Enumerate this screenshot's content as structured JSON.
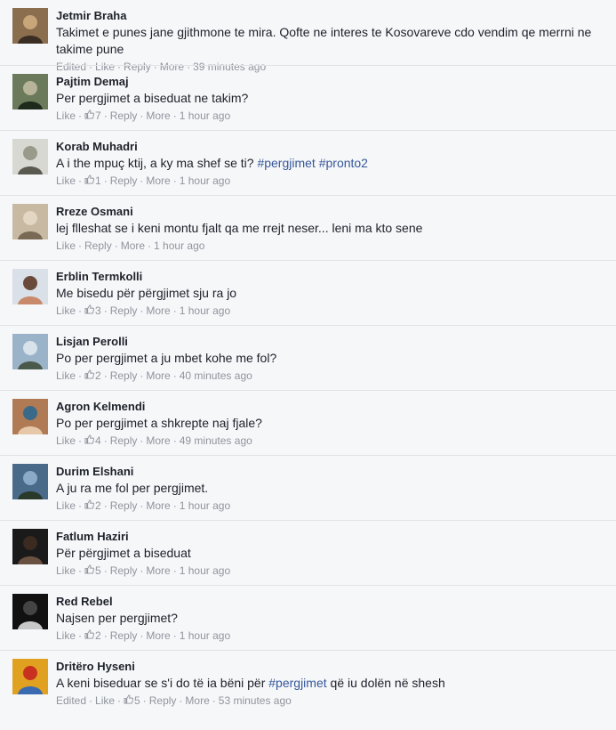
{
  "comments": [
    {
      "name": "Jetmir Braha",
      "text": "Takimet e punes jane gjithmone te mira. Qofte ne interes te Kosovareve cdo vendim qe merrni ne takime pune",
      "edited": "Edited",
      "like": "Like",
      "like_count": "",
      "reply": "Reply",
      "more": "More",
      "time": "39 minutes ago",
      "avatar_colors": [
        "#8a6e4e",
        "#3a2e24",
        "#c9a57a"
      ]
    },
    {
      "name": "Pajtim Demaj",
      "text": "Per pergjimet a biseduat ne takim?",
      "like": "Like",
      "like_count": "7",
      "reply": "Reply",
      "more": "More",
      "time": "1 hour ago",
      "avatar_colors": [
        "#6b7a5a",
        "#1f2a1c",
        "#b8b49a"
      ]
    },
    {
      "name": "Korab Muhadri",
      "text_parts": [
        {
          "t": "A i the mpuç ktij, a ky ma shef se ti? ",
          "tag": false
        },
        {
          "t": "#pergjimet",
          "tag": true
        },
        {
          "t": " ",
          "tag": false
        },
        {
          "t": "#pronto2",
          "tag": true
        }
      ],
      "like": "Like",
      "like_count": "1",
      "reply": "Reply",
      "more": "More",
      "time": "1 hour ago",
      "avatar_colors": [
        "#d8d8d2",
        "#5a5a50",
        "#9a9a8a"
      ]
    },
    {
      "name": "Rreze Osmani",
      "text": "lej flleshat se i keni montu fjalt qa me rrejt neser... leni ma kto sene",
      "like": "Like",
      "like_count": "",
      "reply": "Reply",
      "more": "More",
      "time": "1 hour ago",
      "avatar_colors": [
        "#c7b9a2",
        "#7a6a55",
        "#e3d6c2"
      ]
    },
    {
      "name": "Erblin Termkolli",
      "text": "Me bisedu për përgjimet sju ra jo",
      "like": "Like",
      "like_count": "3",
      "reply": "Reply",
      "more": "More",
      "time": "1 hour ago",
      "avatar_colors": [
        "#d9e0e8",
        "#c88a6a",
        "#6a4a3a"
      ]
    },
    {
      "name": "Lisjan Perolli",
      "text": "Po per pergjimet a ju mbet kohe me fol?",
      "like": "Like",
      "like_count": "2",
      "reply": "Reply",
      "more": "More",
      "time": "40 minutes ago",
      "avatar_colors": [
        "#9bb3c9",
        "#4a5a4a",
        "#d8e2ea"
      ]
    },
    {
      "name": "Agron Kelmendi",
      "text": "Po per pergjimet a shkrepte naj fjale?",
      "like": "Like",
      "like_count": "4",
      "reply": "Reply",
      "more": "More",
      "time": "49 minutes ago",
      "avatar_colors": [
        "#b07a55",
        "#e6c7a8",
        "#3a6a8a"
      ]
    },
    {
      "name": "Durim Elshani",
      "text": "A ju ra me fol per pergjimet.",
      "like": "Like",
      "like_count": "2",
      "reply": "Reply",
      "more": "More",
      "time": "1 hour ago",
      "avatar_colors": [
        "#4a6a8a",
        "#2a3a2a",
        "#8aaac8"
      ]
    },
    {
      "name": "Fatlum Haziri",
      "text": "Për përgjimet a biseduat",
      "like": "Like",
      "like_count": "5",
      "reply": "Reply",
      "more": "More",
      "time": "1 hour ago",
      "avatar_colors": [
        "#1a1a1a",
        "#6a5040",
        "#3a2a20"
      ]
    },
    {
      "name": "Red Rebel",
      "text": "Najsen per pergjimet?",
      "like": "Like",
      "like_count": "2",
      "reply": "Reply",
      "more": "More",
      "time": "1 hour ago",
      "avatar_colors": [
        "#111111",
        "#c8c8c8",
        "#444444"
      ]
    },
    {
      "name": "Dritëro Hyseni",
      "text_parts": [
        {
          "t": "A keni biseduar se s'i do të ia bëni për ",
          "tag": false
        },
        {
          "t": "#pergjimet",
          "tag": true
        },
        {
          "t": " që iu dolën në shesh",
          "tag": false
        }
      ],
      "edited": "Edited",
      "like": "Like",
      "like_count": "5",
      "reply": "Reply",
      "more": "More",
      "time": "53 minutes ago",
      "avatar_colors": [
        "#e0a020",
        "#3a6ab0",
        "#c83020"
      ]
    }
  ],
  "colors": {
    "text": "#1d2129",
    "meta": "#90949c",
    "hashtag": "#365899",
    "divider": "#e1e2e6",
    "background": "#f6f7f9"
  }
}
